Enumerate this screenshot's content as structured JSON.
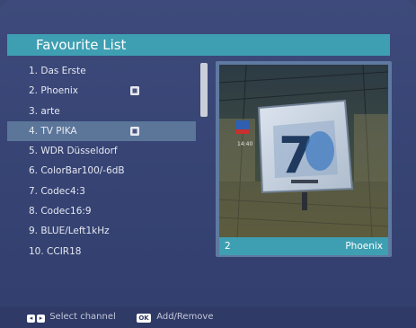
{
  "title": "Favourite List",
  "channels": [
    {
      "label": "1. Das Erste",
      "locked": false
    },
    {
      "label": "2. Phoenix",
      "locked": true
    },
    {
      "label": "3. arte",
      "locked": false
    },
    {
      "label": "4. TV PIKA",
      "locked": true
    },
    {
      "label": "5. WDR Düsseldorf",
      "locked": false
    },
    {
      "label": "6. ColorBar100/-6dB",
      "locked": false
    },
    {
      "label": "7. Codec4:3",
      "locked": false
    },
    {
      "label": "8. Codec16:9",
      "locked": false
    },
    {
      "label": "9. BLUE/Left1kHz",
      "locked": false
    },
    {
      "label": "10. CCIR18",
      "locked": false
    }
  ],
  "selected_index": 3,
  "preview": {
    "number": "2",
    "name": "Phoenix",
    "scoreboard_digit": "7"
  },
  "footer": {
    "select_label": "Select channel",
    "ok_key": "OK",
    "add_remove_label": "Add/Remove"
  },
  "colors": {
    "background": "#3b4876",
    "accent": "#3f9fb2",
    "highlight": "#5b7699"
  },
  "icons": [
    "lock-icon",
    "arrow-left-icon",
    "arrow-right-icon",
    "ok-key-icon"
  ]
}
